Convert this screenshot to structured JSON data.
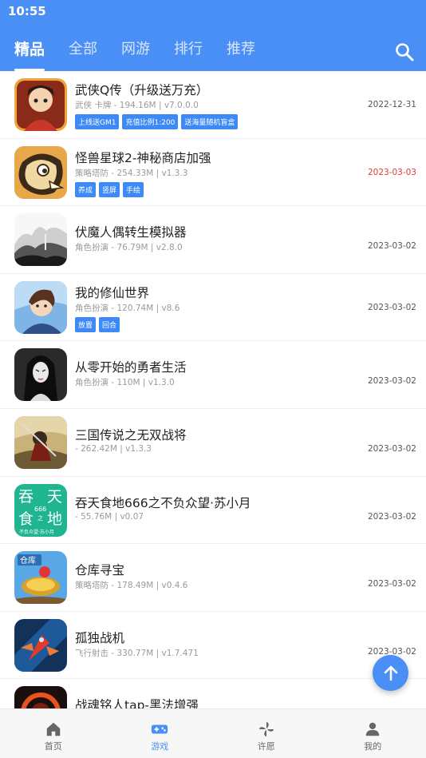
{
  "status": {
    "time": "10:55"
  },
  "tabs": [
    {
      "label": "精品",
      "active": true
    },
    {
      "label": "全部"
    },
    {
      "label": "网游"
    },
    {
      "label": "排行"
    },
    {
      "label": "推荐"
    }
  ],
  "search_icon": "search-icon",
  "games": [
    {
      "title": "武侠Q传（升级送万充）",
      "meta": "武侠 卡牌 - 194.16M | v7.0.0.0",
      "tags": [
        "上线送GM1",
        "充值比例1:200",
        "送海量随机盲盒"
      ],
      "date": "2022-12-31",
      "date_highlight": false
    },
    {
      "title": "怪兽星球2-神秘商店加强",
      "meta": "策略塔防 - 254.33M | v1.3.3",
      "tags": [
        "养成",
        "竖屏",
        "手绘"
      ],
      "date": "2023-03-03",
      "date_highlight": true
    },
    {
      "title": "伏魔人偶转生模拟器",
      "meta": "角色扮演 - 76.79M | v2.8.0",
      "tags": [],
      "date": "2023-03-02",
      "date_highlight": false
    },
    {
      "title": "我的修仙世界",
      "meta": "角色扮演 - 120.74M | v8.6",
      "tags": [
        "放置",
        "回合"
      ],
      "date": "2023-03-02",
      "date_highlight": false
    },
    {
      "title": "从零开始的勇者生活",
      "meta": "角色扮演 - 110M | v1.3.0",
      "tags": [],
      "date": "2023-03-02",
      "date_highlight": false
    },
    {
      "title": "三国传说之无双战将",
      "meta": " - 262.42M | v1.3.3",
      "tags": [],
      "date": "2023-03-02",
      "date_highlight": false
    },
    {
      "title": "吞天食地666之不负众望·苏小月",
      "meta": " - 55.76M | v0.07",
      "tags": [],
      "date": "2023-03-02",
      "date_highlight": false
    },
    {
      "title": "仓库寻宝",
      "meta": "策略塔防 - 178.49M | v0.4.6",
      "tags": [],
      "date": "2023-03-02",
      "date_highlight": false
    },
    {
      "title": "孤独战机",
      "meta": "飞行射击 - 330.77M | v1.7.471",
      "tags": [],
      "date": "2023-03-02",
      "date_highlight": false
    },
    {
      "title": "战魂铭人tap-黑法增强",
      "meta": "",
      "tags": [],
      "date": "",
      "date_highlight": false
    }
  ],
  "icon_text": {
    "tuntian": [
      "吞",
      "天",
      "食",
      "地",
      "666",
      "之",
      "不负众望·苏小月"
    ],
    "cangku": "仓库"
  },
  "bottom_nav": [
    {
      "label": "首页",
      "icon": "home-icon"
    },
    {
      "label": "游戏",
      "icon": "gamepad-icon",
      "active": true
    },
    {
      "label": "许愿",
      "icon": "pinwheel-icon"
    },
    {
      "label": "我的",
      "icon": "user-icon"
    }
  ],
  "colors": {
    "primary": "#4a8ff5",
    "tag": "#3d8af7",
    "highlight_date": "#e53935"
  }
}
